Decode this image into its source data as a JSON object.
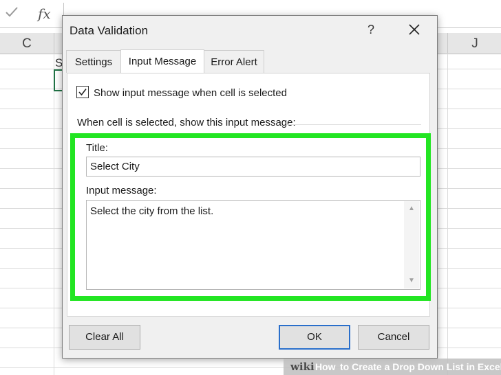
{
  "formula_bar": {
    "check_icon": "checkmark-icon",
    "fx_label": "fx"
  },
  "columns": {
    "c": "C",
    "j": "J"
  },
  "cell_fragment": "S",
  "dialog": {
    "title": "Data Validation",
    "help_label": "?",
    "tabs": [
      {
        "label": "Settings",
        "active": false
      },
      {
        "label": "Input Message",
        "active": true
      },
      {
        "label": "Error Alert",
        "active": false
      }
    ],
    "show_message_checkbox": {
      "checked": true,
      "label": "Show input message when cell is selected"
    },
    "section_label": "When cell is selected, show this input message:",
    "title_field": {
      "label": "Title:",
      "value": "Select City"
    },
    "message_field": {
      "label": "Input message:",
      "value": "Select the city from the list."
    },
    "buttons": {
      "clear_all": "Clear All",
      "ok": "OK",
      "cancel": "Cancel"
    }
  },
  "watermark": {
    "brand": "wiki",
    "how": "How",
    "rest": "to Create a Drop Down List in Excel"
  },
  "colors": {
    "highlight": "#22e522",
    "ok_border": "#2a6fcb",
    "active_cell": "#217346"
  }
}
